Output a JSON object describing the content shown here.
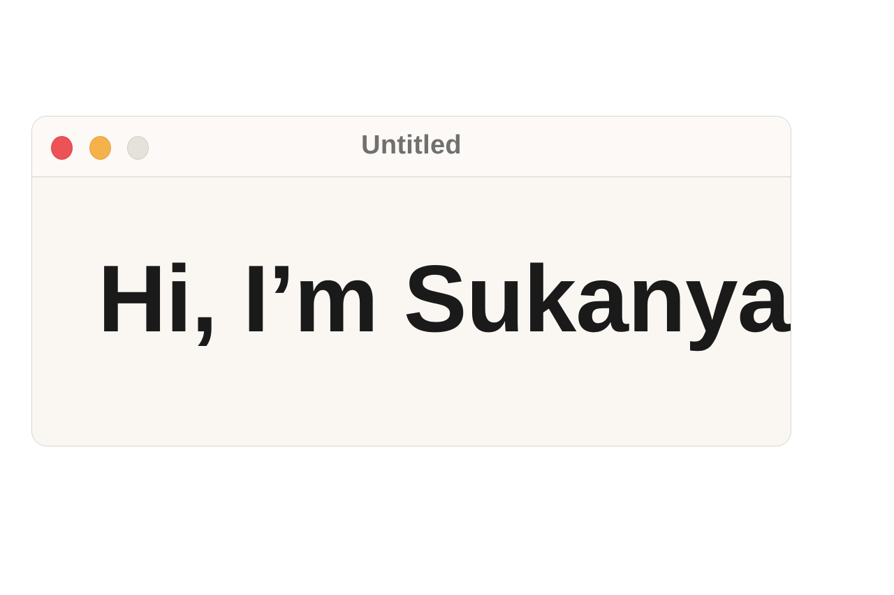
{
  "window": {
    "title": "Untitled",
    "controls": {
      "close_color": "#ec5256",
      "minimize_color": "#f6b24a",
      "zoom_color": "#e4e2da"
    }
  },
  "content": {
    "text": "Hi, I’m Sukanya!"
  }
}
